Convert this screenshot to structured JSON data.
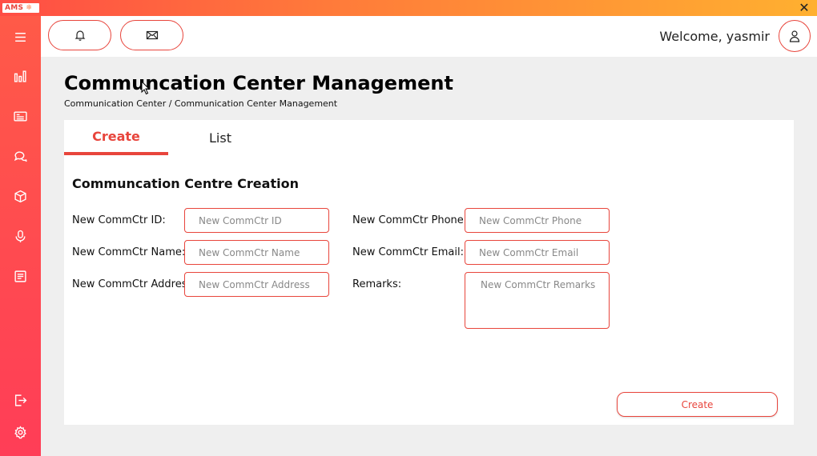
{
  "app": {
    "logo_text": "AMS",
    "logo_glyph": "❄",
    "close_glyph": "✕"
  },
  "colors": {
    "accent": "#e8453c",
    "sidebar_top": "#ff5a48",
    "sidebar_bottom": "#ff3d57",
    "titlebar_end": "#ffb030"
  },
  "sidebar": {
    "items": [
      {
        "icon": "menu-icon"
      },
      {
        "icon": "bar-chart-icon"
      },
      {
        "icon": "id-card-icon"
      },
      {
        "icon": "chat-bubbles-icon"
      },
      {
        "icon": "cube-icon"
      },
      {
        "icon": "microphone-icon"
      },
      {
        "icon": "document-icon"
      },
      {
        "icon": "logout-icon"
      },
      {
        "icon": "settings-gear-icon"
      }
    ]
  },
  "header": {
    "notifications_icon": "bell-icon",
    "messages_icon": "envelope-icon",
    "welcome_text": "Welcome, yasmir",
    "profile_icon": "user-icon"
  },
  "page": {
    "title": "Communcation Center Management",
    "breadcrumb": "Communication Center / Communication Center Management"
  },
  "tabs": [
    {
      "label": "Create",
      "active": true
    },
    {
      "label": "List",
      "active": false
    }
  ],
  "form": {
    "title": "Communcation Centre Creation",
    "fields": {
      "id": {
        "label": "New CommCtr ID:",
        "placeholder": "New CommCtr ID",
        "value": ""
      },
      "name": {
        "label": "New CommCtr Name:",
        "placeholder": "New CommCtr Name",
        "value": ""
      },
      "address": {
        "label": "New CommCtr Address",
        "placeholder": "New CommCtr Address",
        "value": ""
      },
      "phone": {
        "label": "New CommCtr Phone:",
        "placeholder": "New CommCtr Phone",
        "value": ""
      },
      "email": {
        "label": "New CommCtr Email:",
        "placeholder": "New CommCtr Email",
        "value": ""
      },
      "remarks": {
        "label": "Remarks:",
        "placeholder": "New CommCtr Remarks",
        "value": ""
      }
    },
    "submit_label": "Create"
  }
}
